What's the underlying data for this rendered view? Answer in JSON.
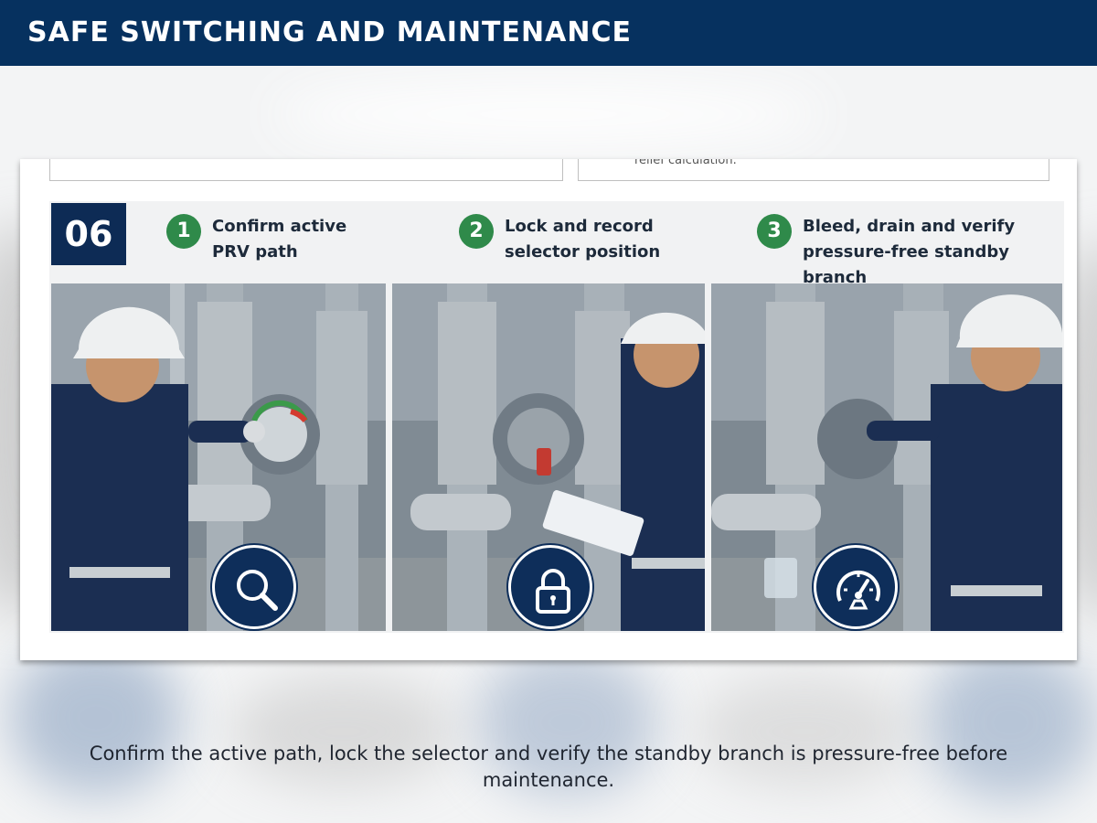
{
  "header": {
    "title": "SAFE SWITCHING AND MAINTENANCE"
  },
  "card": {
    "cut_text": "relief calculation.",
    "step_badge": "06",
    "steps": [
      {
        "number": "1",
        "title": "Confirm active\nPRV path",
        "icon": "magnifier-icon"
      },
      {
        "number": "2",
        "title": "Lock and record\nselector position",
        "icon": "padlock-icon"
      },
      {
        "number": "3",
        "title": "Bleed, drain and verify\npressure-free standby branch",
        "icon": "pressure-gauge-icon"
      }
    ]
  },
  "caption": "Confirm the active path, lock the selector and verify the standby branch is pressure-free before maintenance.",
  "colors": {
    "header_bg": "#06315f",
    "badge_bg": "#0d2b55",
    "step_green": "#2f8a4a",
    "icon_bg": "#0e2e5a"
  }
}
